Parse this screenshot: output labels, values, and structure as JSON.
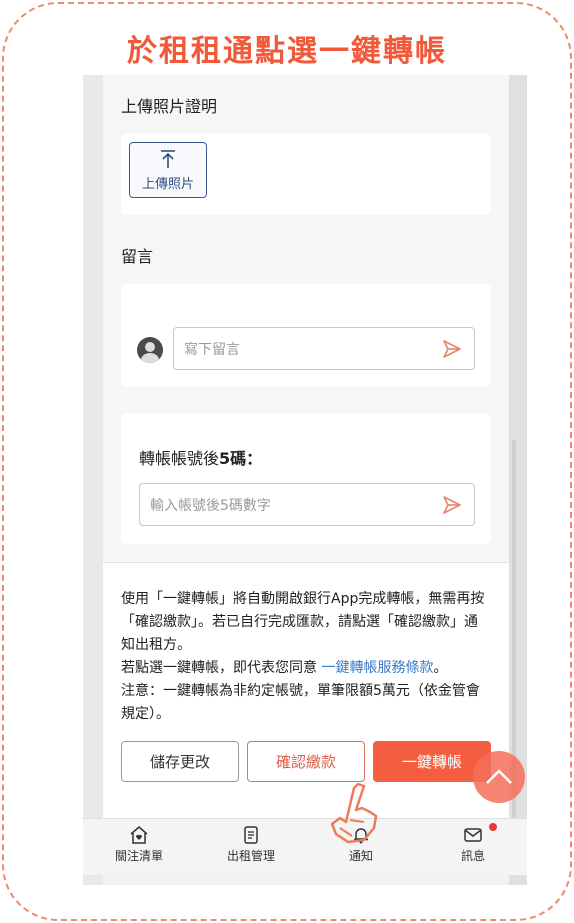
{
  "banner": {
    "title": "於租租通點選一鍵轉帳"
  },
  "upload_section": {
    "title": "上傳照片證明",
    "upload_button": "上傳照片"
  },
  "comment_section": {
    "title": "留言",
    "input_placeholder": "寫下留言"
  },
  "transfer_section": {
    "label_prefix": "轉帳帳號後",
    "label_bold": "5碼：",
    "input_placeholder": "輸入帳號後5碼數字"
  },
  "notice": {
    "line1": "使用「一鍵轉帳」將自動開啟銀行App完成轉帳，無需再按「確認繳款」。若已自行完成匯款，請點選「確認繳款」通知出租方。",
    "line2_prefix": "若點選一鍵轉帳，即代表您同意 ",
    "line2_link": "一鍵轉帳服務條款",
    "line2_suffix": "。",
    "line3": "注意：一鍵轉帳為非約定帳號，單筆限額5萬元（依金管會規定）。"
  },
  "actions": {
    "save": "儲存更改",
    "confirm": "確認繳款",
    "one_key": "一鍵轉帳"
  },
  "tabbar": {
    "items": [
      {
        "label": "關注清單",
        "icon": "home-heart-icon"
      },
      {
        "label": "出租管理",
        "icon": "document-icon"
      },
      {
        "label": "通知",
        "icon": "bell-icon"
      },
      {
        "label": "訊息",
        "icon": "mail-icon",
        "badge": true
      }
    ]
  },
  "colors": {
    "accent": "#f45d3f",
    "banner": "#f05a3a",
    "link": "#3a7bc8",
    "badge": "#e53935"
  }
}
